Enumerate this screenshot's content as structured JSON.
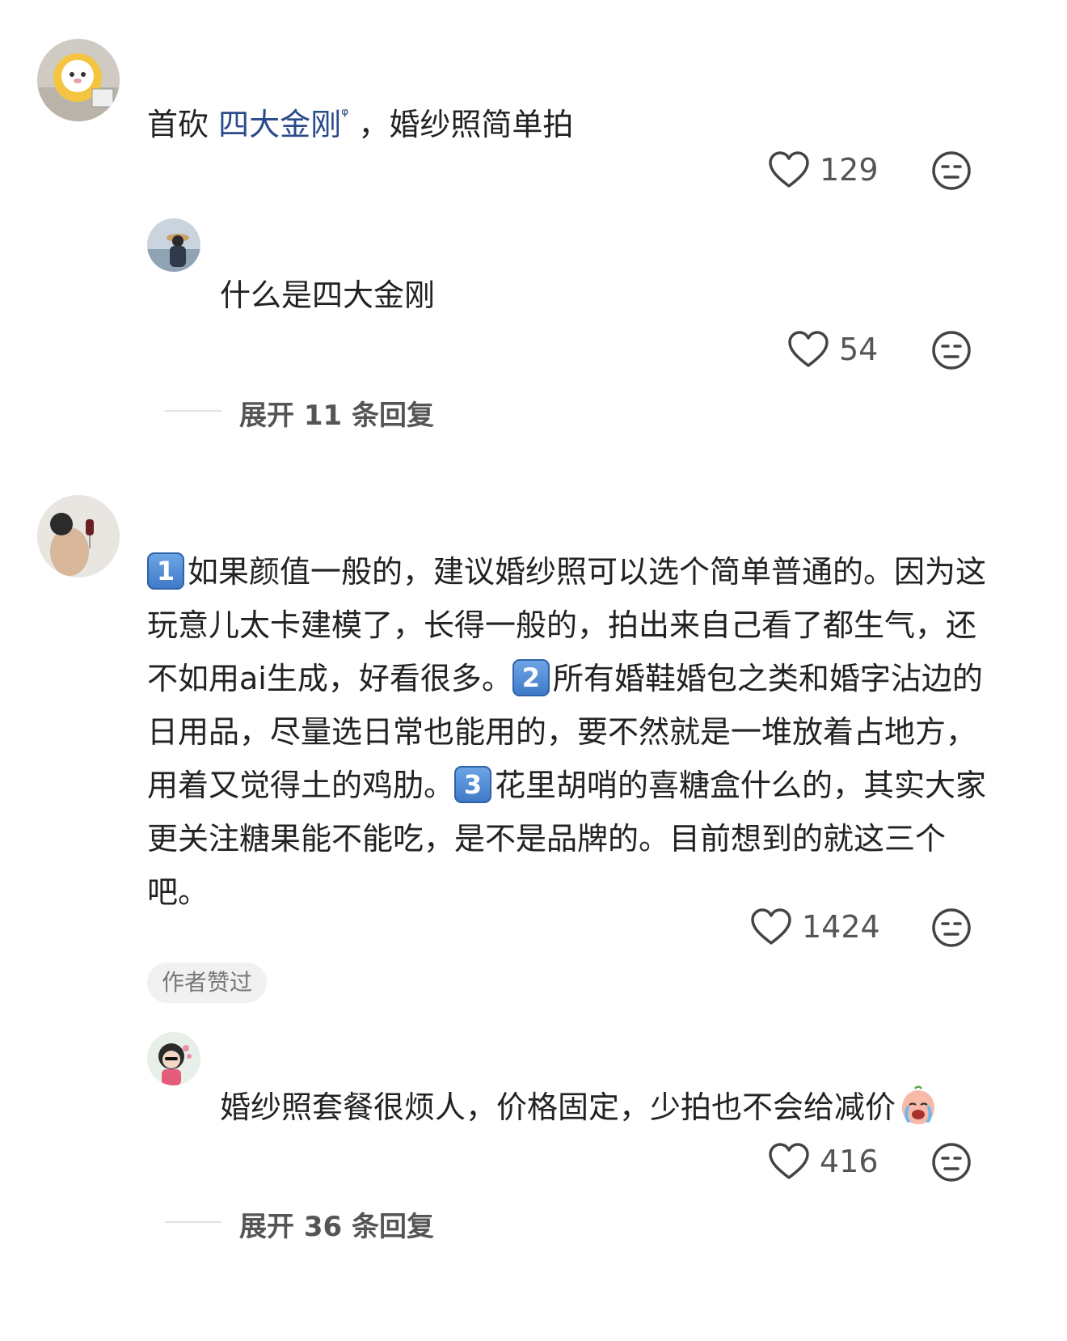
{
  "comments": [
    {
      "text_prefix": "首砍",
      "link_text": "四大金刚",
      "text_suffix": "，婚纱照简单拍",
      "likes": "129",
      "reply": {
        "text": "什么是四大金刚",
        "likes": "54",
        "expand": "展开 11 条回复"
      }
    },
    {
      "parts": [
        {
          "num": "1",
          "text": "如果颜值一般的，建议婚纱照可以选个简单普通的。因为这玩意儿太卡建模了，长得一般的，拍出来自己看了都生气，还不如用ai生成，好看很多。"
        },
        {
          "num": "2",
          "text": "所有婚鞋婚包之类和婚字沾边的日用品，尽量选日常也能用的，要不然就是一堆放着占地方，用着又觉得土的鸡肋。"
        },
        {
          "num": "3",
          "text": "花里胡哨的喜糖盒什么的，其实大家更关注糖果能不能吃，是不是品牌的。目前想到的就这三个吧。"
        }
      ],
      "likes": "1424",
      "badge": "作者赞过",
      "reply": {
        "text": "婚纱照套餐很烦人，价格固定，少拍也不会给减价",
        "likes": "416",
        "expand": "展开 36 条回复"
      }
    }
  ],
  "icons": {
    "like": "heart-outline-icon",
    "dislike": "unamused-face-icon",
    "search": "search-superscript-icon",
    "emoji": "crying-face-emoji"
  }
}
